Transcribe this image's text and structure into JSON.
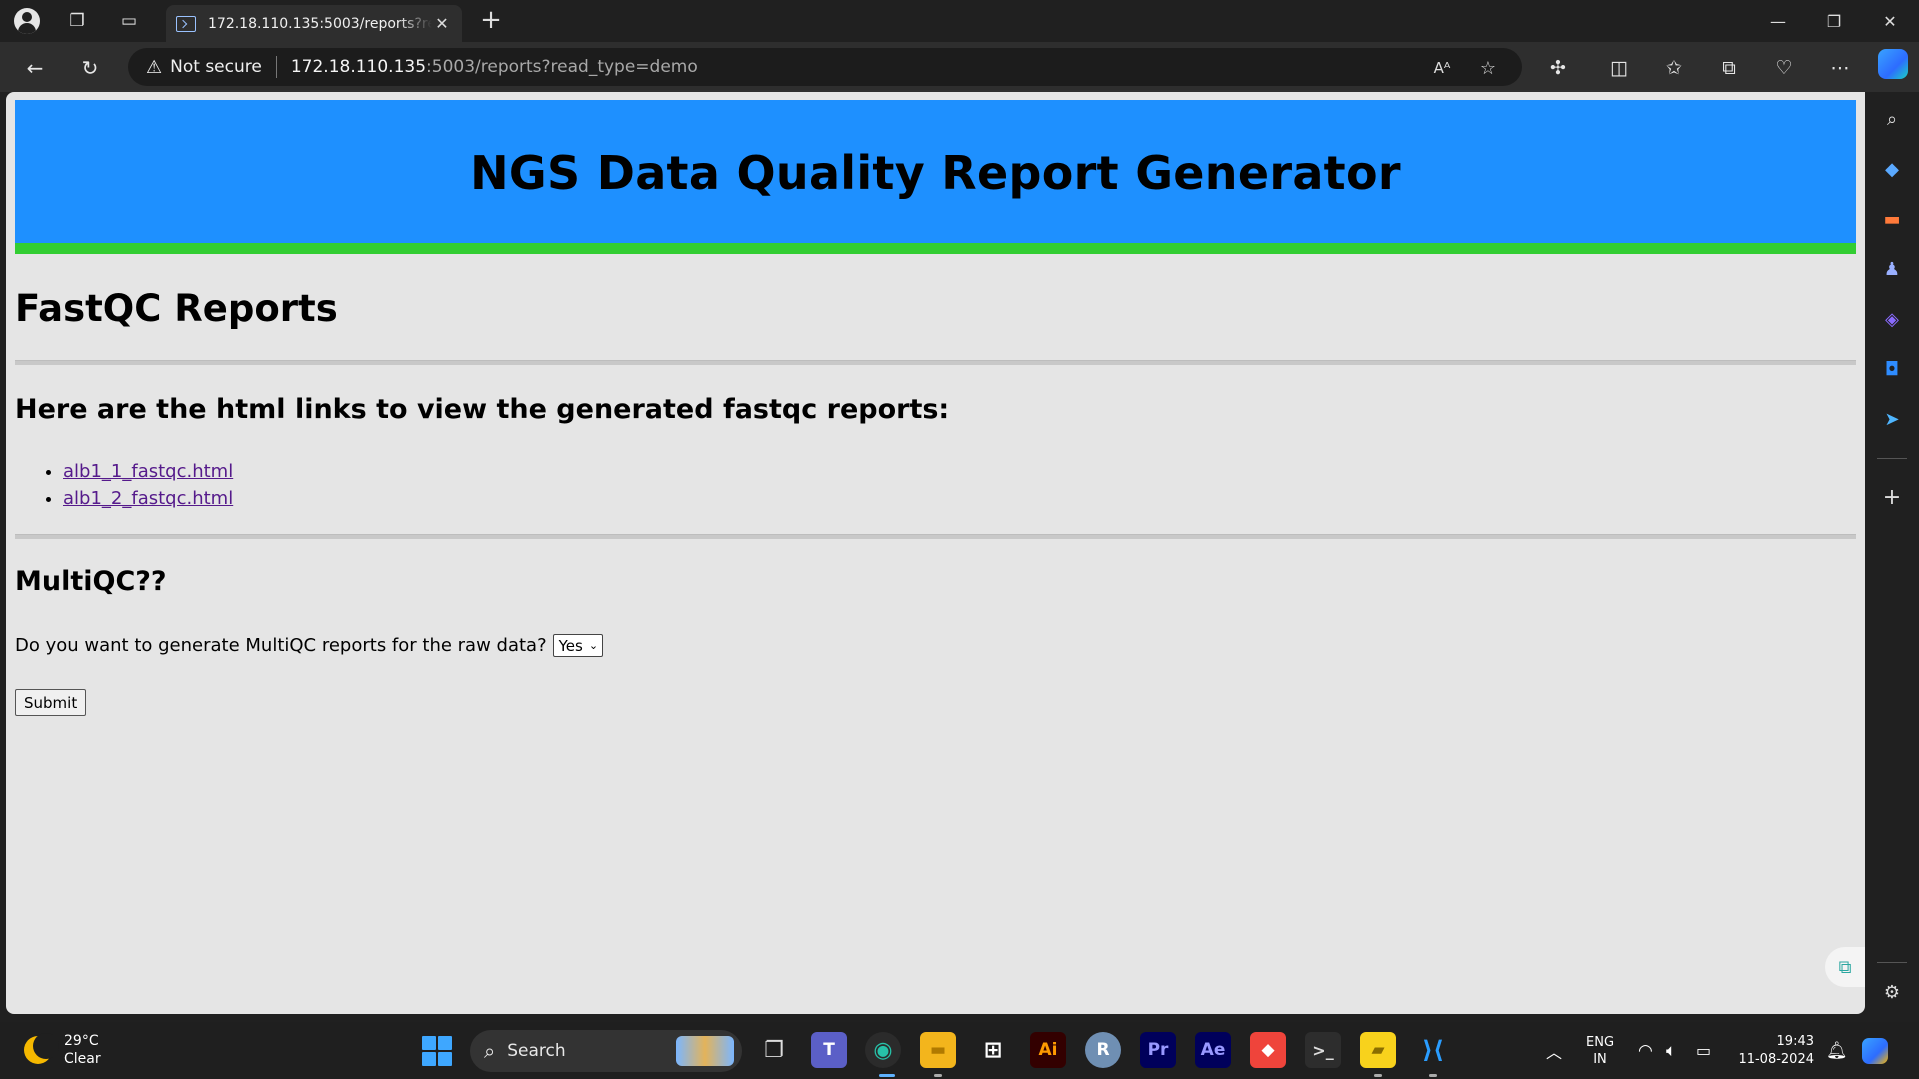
{
  "browser": {
    "tab_title": "172.18.110.135:5003/reports?read_type=demo",
    "security_label": "Not secure",
    "url_host": "172.18.110.135",
    "url_rest": ":5003/reports?read_type=demo"
  },
  "page": {
    "banner_title": "NGS Data Quality Report Generator",
    "fastqc_heading": "FastQC Reports",
    "links_heading": "Here are the html links to view the generated fastqc reports:",
    "reports": [
      {
        "label": "alb1_1_fastqc.html"
      },
      {
        "label": "alb1_2_fastqc.html"
      }
    ],
    "multiqc_heading": "MultiQC??",
    "multiqc_question": "Do you want to generate MultiQC reports for the raw data?",
    "multiqc_selected": "Yes",
    "submit_label": "Submit"
  },
  "taskbar": {
    "temperature": "29°C",
    "condition": "Clear",
    "search_label": "Search",
    "language_top": "ENG",
    "language_bottom": "IN",
    "time": "19:43",
    "date": "11-08-2024"
  },
  "colors": {
    "banner": "#1e90ff",
    "banner_border": "#32cd32",
    "page_bg": "#e5e5e5",
    "visited_link": "#551a8b"
  }
}
